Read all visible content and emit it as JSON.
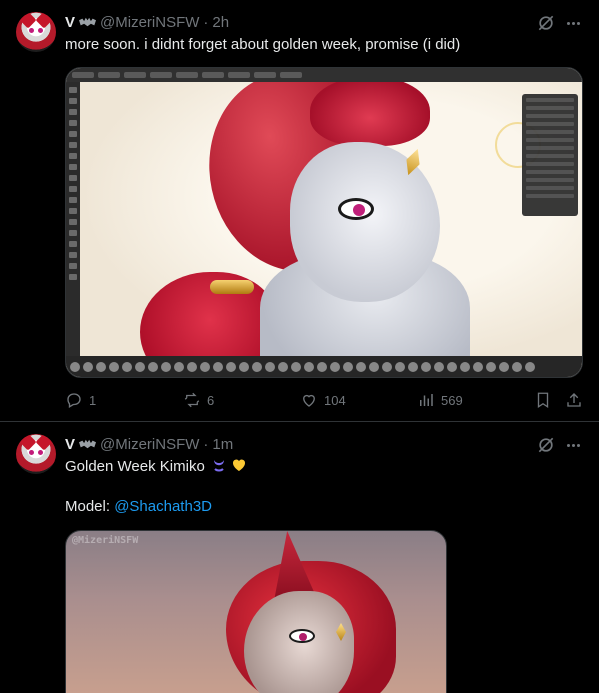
{
  "tweets": [
    {
      "display_name": "V",
      "badge_icon": "bat-icon",
      "handle": "@MizeriNSFW",
      "time": "2h",
      "text": "more soon. i didnt forget about golden week, promise (i did)",
      "media_description": "",
      "stats": {
        "replies": "1",
        "retweets": "6",
        "likes": "104",
        "views": "569"
      }
    },
    {
      "display_name": "V",
      "badge_icon": "bat-icon",
      "handle": "@MizeriNSFW",
      "time": "1m",
      "text_line1": "Golden Week Kimiko",
      "text_line2_prefix": "Model: ",
      "text_line2_mention": "@Shachath3D",
      "media_watermark": "@MizeriNSFW"
    }
  ],
  "colors": {
    "background": "#000000",
    "text": "#e7e9ea",
    "muted": "#71767b",
    "link": "#1d9bf0",
    "border": "#2f3336"
  }
}
